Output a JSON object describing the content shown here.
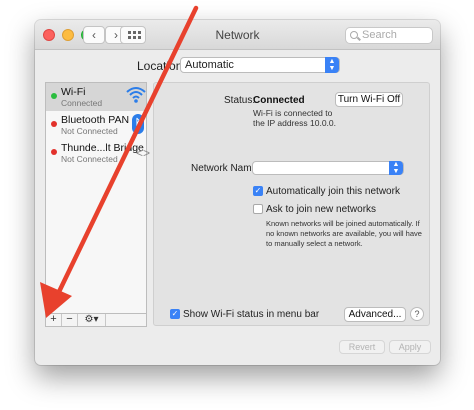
{
  "window": {
    "title": "Network"
  },
  "search": {
    "placeholder": "Search"
  },
  "location": {
    "label": "Location:",
    "value": "Automatic"
  },
  "services": [
    {
      "name": "Wi-Fi",
      "status": "Connected",
      "state_color": "#2bbd3f",
      "icon": "wifi-icon"
    },
    {
      "name": "Bluetooth PAN",
      "status": "Not Connected",
      "state_color": "#e2312b",
      "icon": "bluetooth-icon"
    },
    {
      "name": "Thunde...lt Bridge",
      "status": "Not Connected",
      "state_color": "#e2312b",
      "icon": "thunderbolt-icon"
    }
  ],
  "sidebar_toolbar": {
    "add": "+",
    "remove": "−",
    "gear": "⚙▾"
  },
  "detail": {
    "status_label": "Status:",
    "status_value": "Connected",
    "turn_off_button": "Turn Wi-Fi Off",
    "status_desc_1": "Wi-Fi is connected to",
    "status_desc_2": "the IP address 10.0.0.",
    "network_name_label": "Network Name:",
    "network_name_value": "",
    "auto_join": {
      "label": "Automatically join this network",
      "checked": true
    },
    "ask_join": {
      "label": "Ask to join new networks",
      "checked": false
    },
    "note_1": "Known networks will be joined automatically. If",
    "note_2": "no known networks are available, you will have",
    "note_3": "to manually select a network.",
    "show_menu": {
      "label": "Show Wi-Fi status in menu bar",
      "checked": true
    },
    "advanced_button": "Advanced...",
    "help_button": "?"
  },
  "footer": {
    "revert": "Revert",
    "apply": "Apply"
  },
  "colors": {
    "accent": "#3a82f6",
    "arrow": "#e8412d"
  }
}
